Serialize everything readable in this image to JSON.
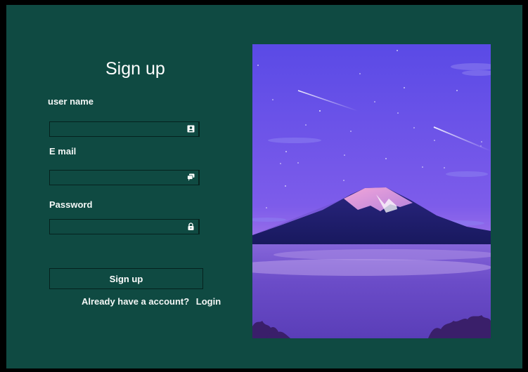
{
  "form": {
    "title": "Sign up",
    "username_label": "user name",
    "username_value": "",
    "email_label": "E mail",
    "email_value": "",
    "password_label": "Password",
    "password_value": "",
    "submit_label": "Sign up",
    "account_prompt": "Already have a account?",
    "login_link": "Login"
  },
  "icons": {
    "username": "contact-card-icon",
    "email": "chat-bubbles-icon",
    "password": "lock-icon"
  },
  "colors": {
    "background": "#0f4a42",
    "text": "#ffffff",
    "sky_top": "#5d4de7",
    "sky_bottom": "#a879ea",
    "mountain": "#1e1e6a"
  }
}
